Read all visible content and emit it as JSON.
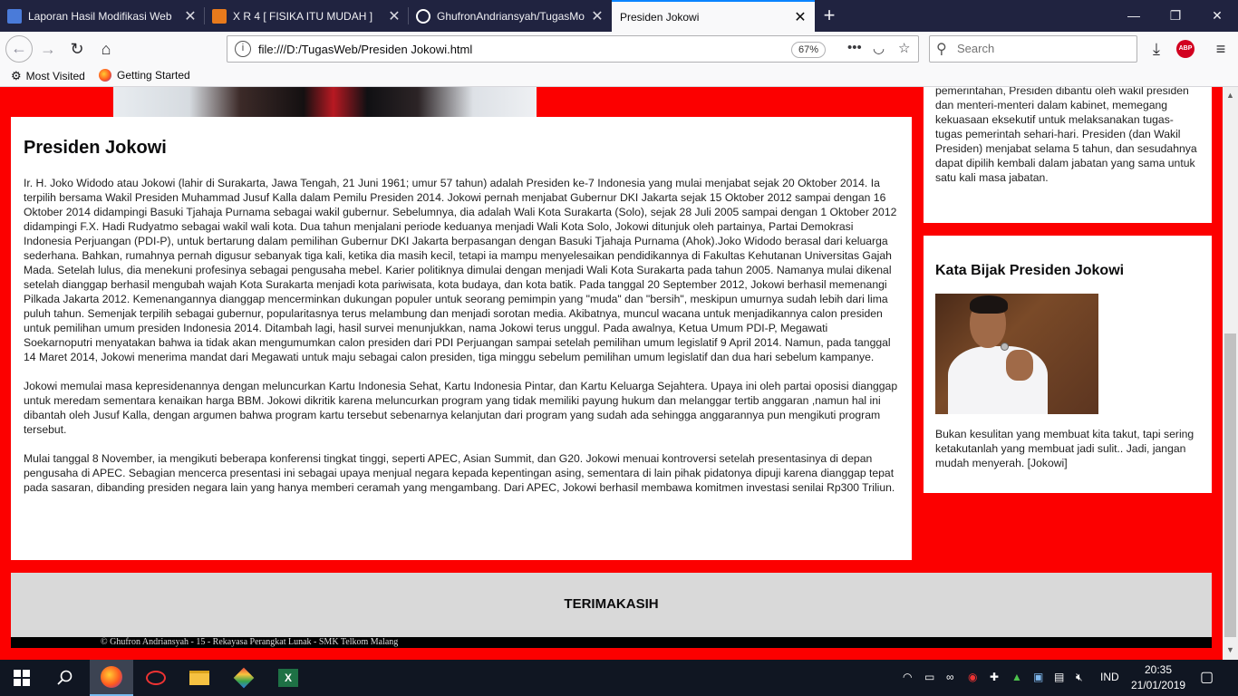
{
  "browser": {
    "tabs": [
      {
        "title": "Laporan Hasil Modifikasi Web",
        "favicon": "doc-icon",
        "color": "#4a7bd9"
      },
      {
        "title": "X R 4 [ FISIKA ITU MUDAH ]",
        "favicon": "slides-icon",
        "color": "#e87a1c"
      },
      {
        "title": "GhufronAndriansyah/TugasMo",
        "favicon": "github-icon",
        "color": "#ffffff"
      },
      {
        "title": "Presiden Jokowi",
        "favicon": "",
        "color": ""
      }
    ],
    "new_tab_label": "+",
    "url": "file:///D:/TugasWeb/Presiden Jokowi.html",
    "zoom": "67%",
    "search_placeholder": "Search",
    "abp_label": "ABP",
    "bookmarks": [
      "Most Visited",
      "Getting Started"
    ]
  },
  "page": {
    "title": "Presiden Jokowi",
    "paragraphs": [
      "Ir. H. Joko Widodo atau Jokowi (lahir di Surakarta, Jawa Tengah, 21 Juni 1961; umur 57 tahun) adalah Presiden ke-7 Indonesia yang mulai menjabat sejak 20 Oktober 2014. Ia terpilih bersama Wakil Presiden Muhammad Jusuf Kalla dalam Pemilu Presiden 2014. Jokowi pernah menjabat Gubernur DKI Jakarta sejak 15 Oktober 2012 sampai dengan 16 Oktober 2014 didampingi Basuki Tjahaja Purnama sebagai wakil gubernur. Sebelumnya, dia adalah Wali Kota Surakarta (Solo), sejak 28 Juli 2005 sampai dengan 1 Oktober 2012 didampingi F.X. Hadi Rudyatmo sebagai wakil wali kota. Dua tahun menjalani periode keduanya menjadi Wali Kota Solo, Jokowi ditunjuk oleh partainya, Partai Demokrasi Indonesia Perjuangan (PDI-P), untuk bertarung dalam pemilihan Gubernur DKI Jakarta berpasangan dengan Basuki Tjahaja Purnama (Ahok).Joko Widodo berasal dari keluarga sederhana. Bahkan, rumahnya pernah digusur sebanyak tiga kali, ketika dia masih kecil, tetapi ia mampu menyelesaikan pendidikannya di Fakultas Kehutanan Universitas Gajah Mada. Setelah lulus, dia menekuni profesinya sebagai pengusaha mebel. Karier politiknya dimulai dengan menjadi Wali Kota Surakarta pada tahun 2005. Namanya mulai dikenal setelah dianggap berhasil mengubah wajah Kota Surakarta menjadi kota pariwisata, kota budaya, dan kota batik. Pada tanggal 20 September 2012, Jokowi berhasil memenangi Pilkada Jakarta 2012. Kemenangannya dianggap mencerminkan dukungan populer untuk seorang pemimpin yang \"muda\" dan \"bersih\", meskipun umurnya sudah lebih dari lima puluh tahun. Semenjak terpilih sebagai gubernur, popularitasnya terus melambung dan menjadi sorotan media. Akibatnya, muncul wacana untuk menjadikannya calon presiden untuk pemilihan umum presiden Indonesia 2014. Ditambah lagi, hasil survei menunjukkan, nama Jokowi terus unggul. Pada awalnya, Ketua Umum PDI-P, Megawati Soekarnoputri menyatakan bahwa ia tidak akan mengumumkan calon presiden dari PDI Perjuangan sampai setelah pemilihan umum legislatif 9 April 2014. Namun, pada tanggal 14 Maret 2014, Jokowi menerima mandat dari Megawati untuk maju sebagai calon presiden, tiga minggu sebelum pemilihan umum legislatif dan dua hari sebelum kampanye.",
      "Jokowi memulai masa kepresidenannya dengan meluncurkan Kartu Indonesia Sehat, Kartu Indonesia Pintar, dan Kartu Keluarga Sejahtera. Upaya ini oleh partai oposisi dianggap untuk meredam sementara kenaikan harga BBM. Jokowi dikritik karena meluncurkan program yang tidak memiliki payung hukum dan melanggar tertib anggaran ,namun hal ini dibantah oleh Jusuf Kalla, dengan argumen bahwa program kartu tersebut sebenarnya kelanjutan dari program yang sudah ada sehingga anggarannya pun mengikuti program tersebut.",
      "Mulai tanggal 8 November, ia mengikuti beberapa konferensi tingkat tinggi, seperti APEC, Asian Summit, dan G20. Jokowi menuai kontroversi setelah presentasinya di depan pengusaha di APEC. Sebagian mencerca presentasi ini sebagai upaya menjual negara kepada kepentingan asing, sementara di lain pihak pidatonya dipuji karena dianggap tepat pada sasaran, dibanding presiden negara lain yang hanya memberi ceramah yang mengambang. Dari APEC, Jokowi berhasil membawa komitmen investasi senilai Rp300 Triliun."
    ],
    "sidebar_text": "pemerintahan, Presiden dibantu oleh wakil presiden dan menteri-menteri dalam kabinet, memegang kekuasaan eksekutif untuk melaksanakan tugas-tugas pemerintah sehari-hari. Presiden (dan Wakil Presiden) menjabat selama 5 tahun, dan sesudahnya dapat dipilih kembali dalam jabatan yang sama untuk satu kali masa jabatan.",
    "quote_title": "Kata Bijak Presiden Jokowi",
    "quote_text": "Bukan kesulitan yang membuat kita takut, tapi sering ketakutanlah yang membuat jadi sulit.. Jadi, jangan mudah menyerah. [Jokowi]",
    "footer_thanks": "TERIMAKASIH",
    "copyright": "© Ghufron Andriansyah - 15 - Rekayasa Perangkat Lunak - SMK Telkom Malang"
  },
  "taskbar": {
    "language": "IND",
    "time": "20:35",
    "date": "21/01/2019"
  },
  "colors": {
    "page_background": "#fc0000",
    "tab_active_accent": "#0a84ff",
    "footer": "#d9d9d9"
  }
}
